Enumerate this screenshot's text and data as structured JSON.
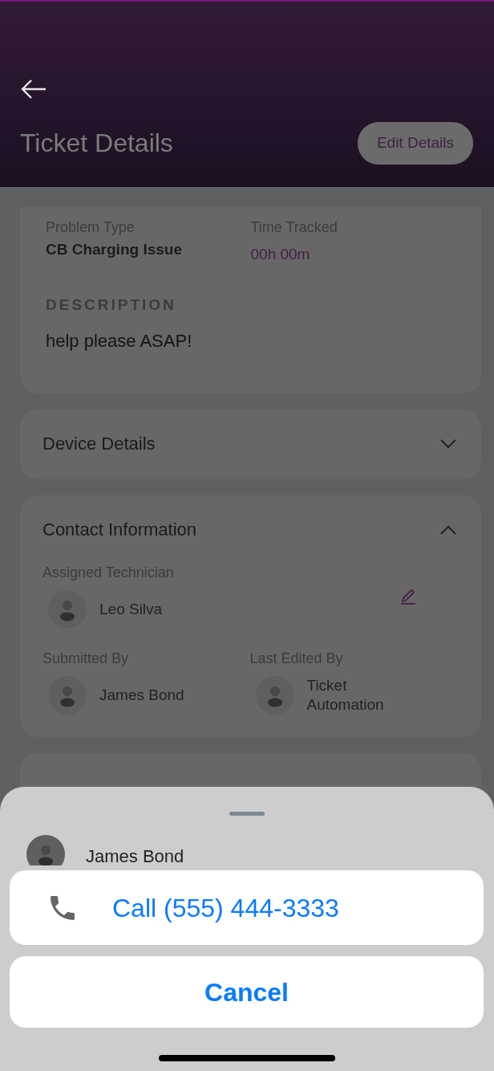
{
  "header": {
    "title": "Ticket Details",
    "edit_button": "Edit Details"
  },
  "summary": {
    "fields": [
      {
        "label": "Problem Type",
        "value": "CB Charging Issue",
        "kind": "plain"
      },
      {
        "label": "Time Tracked",
        "value": "00h 00m",
        "kind": "accent"
      }
    ],
    "description_label": "DESCRIPTION",
    "description": "help please ASAP!"
  },
  "sections": [
    {
      "title": "Device Details",
      "expanded": false
    },
    {
      "title": "Contact Information",
      "expanded": true,
      "assigned": {
        "label": "Assigned Technician",
        "name": "Leo Silva"
      },
      "people": [
        {
          "label": "Submitted By",
          "name": "James Bond"
        },
        {
          "label": "Last Edited By",
          "name": "Ticket Automation"
        }
      ]
    }
  ],
  "sheet": {
    "contact_name": "James Bond",
    "actions": [
      {
        "label": "Call (555) 444-3333",
        "kind": "call"
      },
      {
        "label": "Cancel",
        "kind": "cancel"
      }
    ]
  }
}
